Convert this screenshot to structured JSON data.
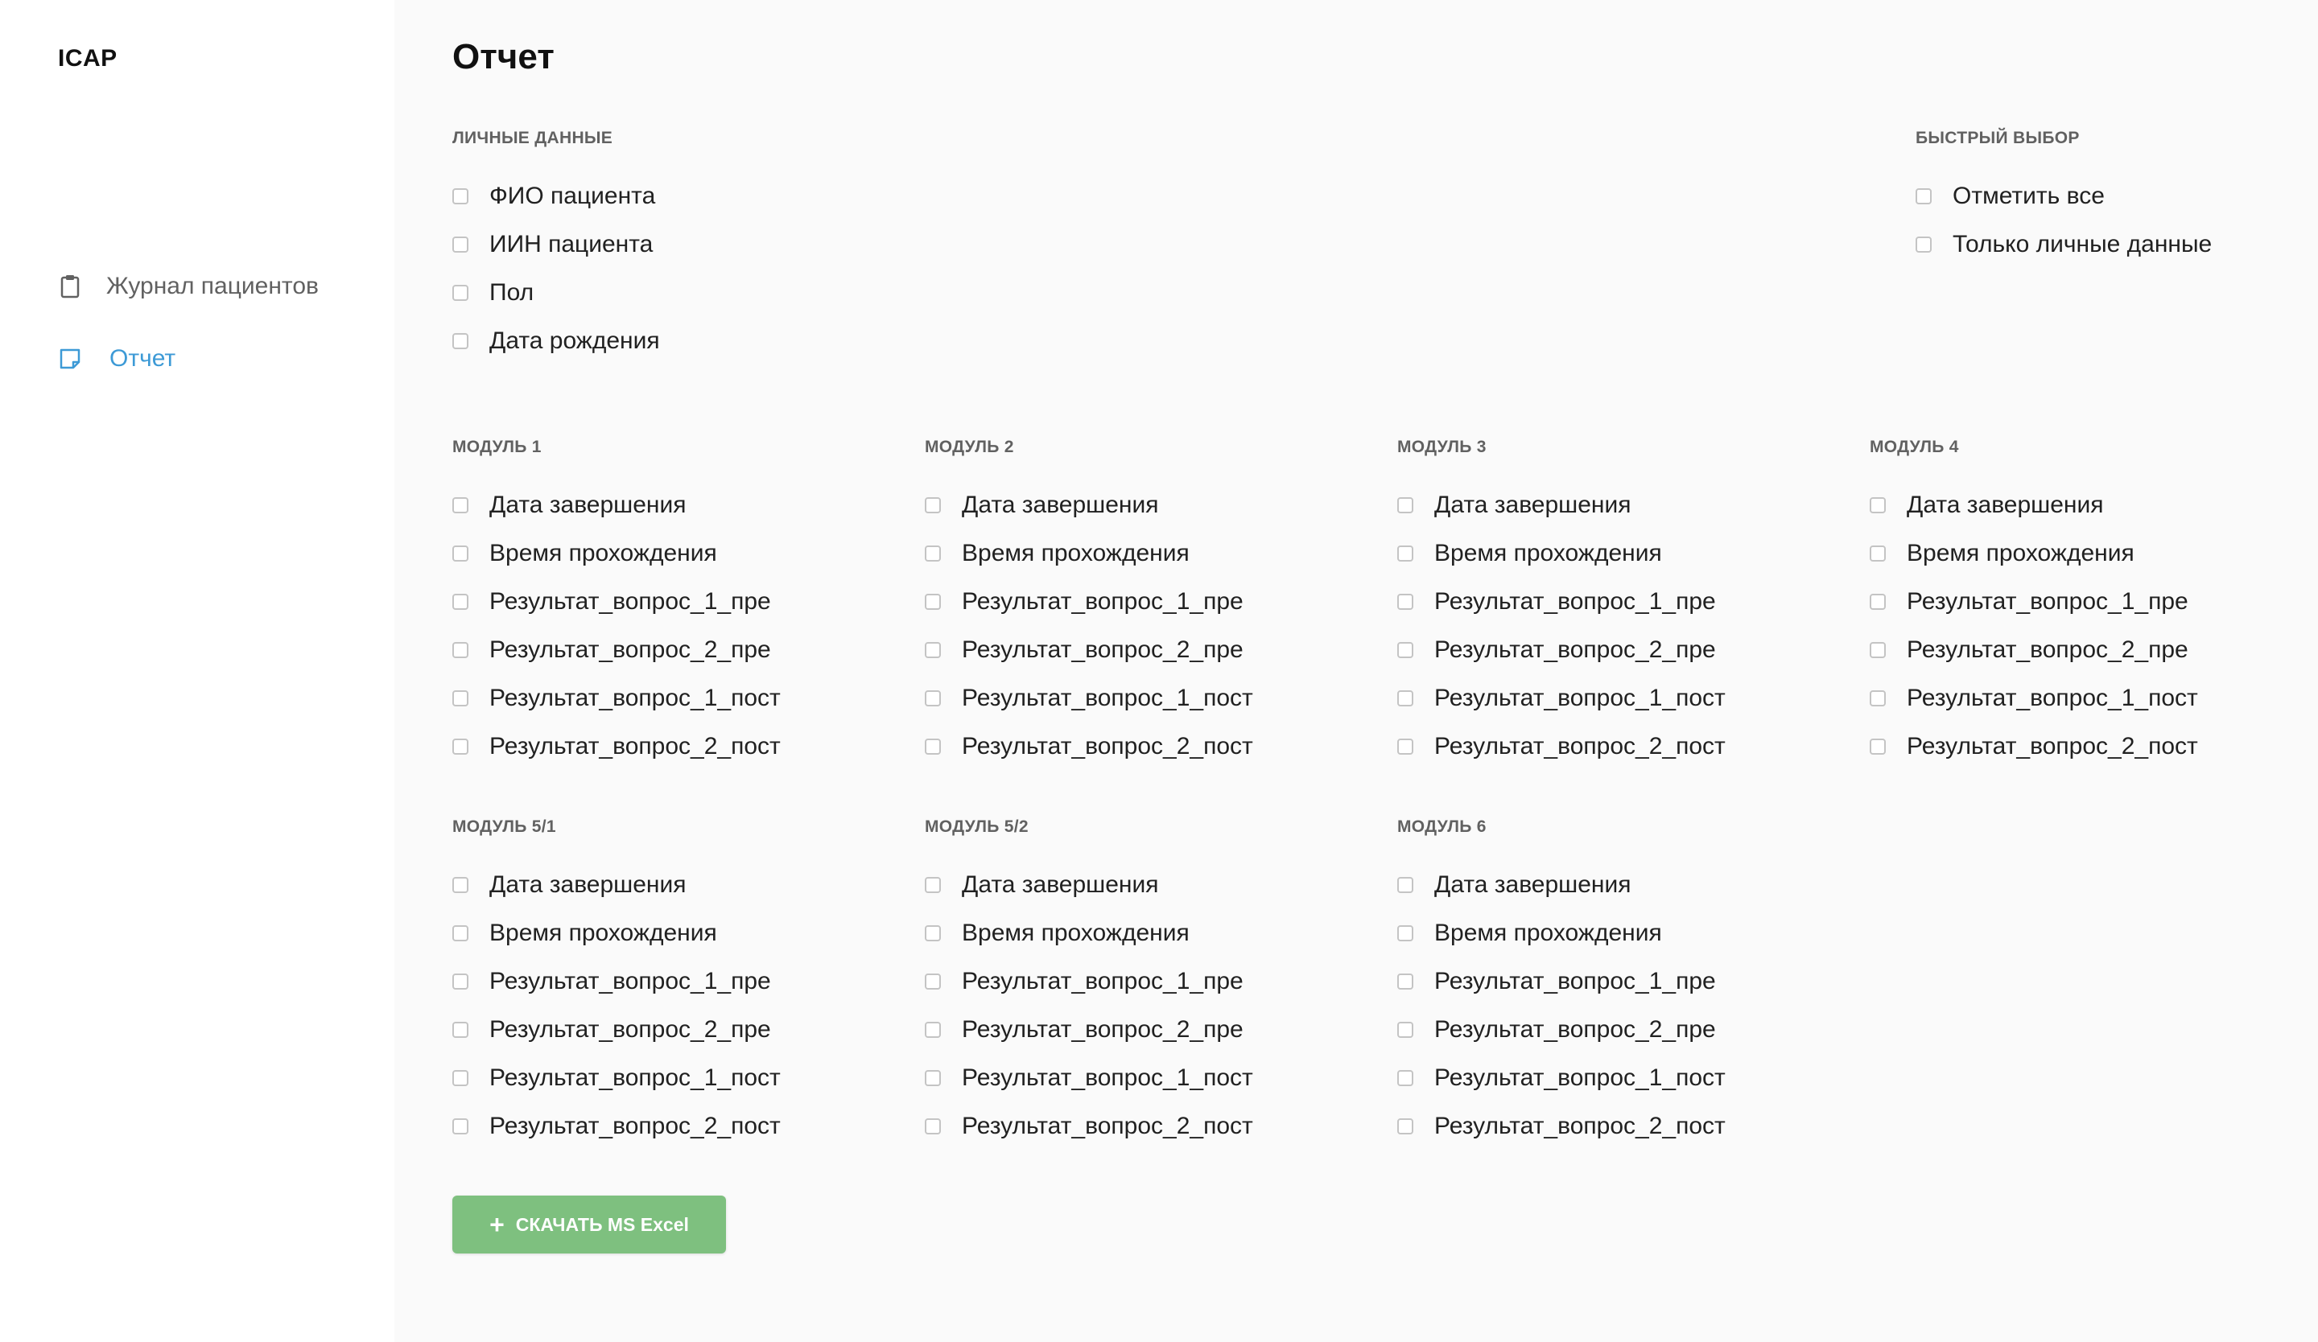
{
  "sidebar": {
    "brand": "ICAP",
    "items": [
      {
        "label": "Журнал пациентов",
        "icon": "clipboard-icon"
      },
      {
        "label": "Отчет",
        "icon": "note-icon",
        "active": true
      }
    ]
  },
  "main": {
    "title": "Отчет",
    "personal": {
      "title": "ЛИЧНЫЕ ДАННЫЕ",
      "items": [
        "ФИО пациента",
        "ИИН пациента",
        "Пол",
        "Дата рождения"
      ]
    },
    "quick": {
      "title": "БЫСТРЫЙ ВЫБОР",
      "items": [
        "Отметить все",
        "Только личные данные"
      ]
    },
    "modules": [
      {
        "title": "МОДУЛЬ 1",
        "items": [
          "Дата завершения",
          "Время прохождения",
          "Результат_вопрос_1_пре",
          "Результат_вопрос_2_пре",
          "Результат_вопрос_1_пост",
          "Результат_вопрос_2_пост"
        ]
      },
      {
        "title": "МОДУЛЬ 2",
        "items": [
          "Дата завершения",
          "Время прохождения",
          "Результат_вопрос_1_пре",
          "Результат_вопрос_2_пре",
          "Результат_вопрос_1_пост",
          "Результат_вопрос_2_пост"
        ]
      },
      {
        "title": "МОДУЛЬ 3",
        "items": [
          "Дата завершения",
          "Время прохождения",
          "Результат_вопрос_1_пре",
          "Результат_вопрос_2_пре",
          "Результат_вопрос_1_пост",
          "Результат_вопрос_2_пост"
        ]
      },
      {
        "title": "МОДУЛЬ 4",
        "items": [
          "Дата завершения",
          "Время прохождения",
          "Результат_вопрос_1_пре",
          "Результат_вопрос_2_пре",
          "Результат_вопрос_1_пост",
          "Результат_вопрос_2_пост"
        ]
      },
      {
        "title": "МОДУЛЬ 5/1",
        "items": [
          "Дата завершения",
          "Время прохождения",
          "Результат_вопрос_1_пре",
          "Результат_вопрос_2_пре",
          "Результат_вопрос_1_пост",
          "Результат_вопрос_2_пост"
        ]
      },
      {
        "title": "МОДУЛЬ 5/2",
        "items": [
          "Дата завершения",
          "Время прохождения",
          "Результат_вопрос_1_пре",
          "Результат_вопрос_2_пре",
          "Результат_вопрос_1_пост",
          "Результат_вопрос_2_пост"
        ]
      },
      {
        "title": "МОДУЛЬ 6",
        "items": [
          "Дата завершения",
          "Время прохождения",
          "Результат_вопрос_1_пре",
          "Результат_вопрос_2_пре",
          "Результат_вопрос_1_пост",
          "Результат_вопрос_2_пост"
        ]
      }
    ],
    "download_label": "СКАЧАТЬ MS Excel"
  },
  "colors": {
    "accent": "#3d9ad6",
    "button": "#7ec07f",
    "main_bg": "#fafafa"
  }
}
